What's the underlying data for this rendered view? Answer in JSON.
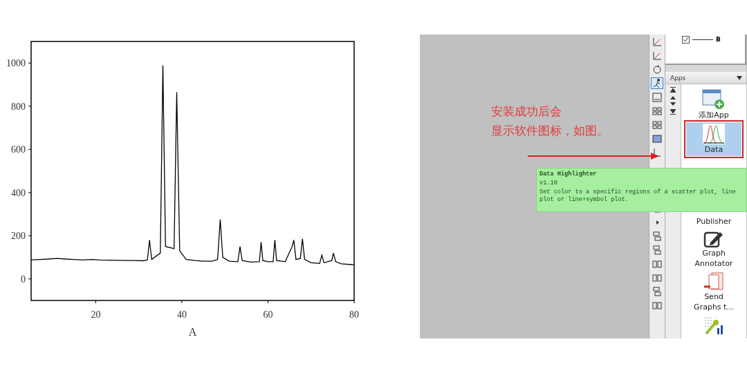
{
  "chart": {
    "chart_data": {
      "type": "line",
      "xlabel": "A",
      "xlim": [
        5,
        80
      ],
      "ylim": [
        -100,
        1100
      ],
      "xticks": [
        20,
        40,
        60,
        80
      ],
      "yticks": [
        0,
        200,
        400,
        600,
        800,
        1000
      ],
      "x": [
        5,
        7,
        9,
        11,
        13,
        15,
        17,
        19,
        21,
        23,
        25,
        27,
        29,
        31,
        32,
        32.5,
        33,
        35,
        35.6,
        36.2,
        38.2,
        38.8,
        39.5,
        41,
        43,
        45,
        47,
        48.3,
        48.9,
        49.5,
        51,
        53,
        53.5,
        54,
        56,
        58,
        58.4,
        58.8,
        60,
        61.2,
        61.6,
        62,
        64,
        65.6,
        66,
        66.5,
        67.5,
        68,
        68.5,
        70,
        72,
        72.5,
        73,
        74.8,
        75.2,
        75.7,
        77,
        80
      ],
      "series": [
        {
          "color": "#000000",
          "values": [
            88,
            90,
            92,
            95,
            92,
            90,
            88,
            90,
            88,
            87,
            86,
            85,
            85,
            84,
            88,
            180,
            90,
            120,
            990,
            150,
            140,
            865,
            130,
            90,
            85,
            82,
            82,
            90,
            275,
            100,
            82,
            80,
            150,
            85,
            78,
            80,
            170,
            85,
            80,
            80,
            180,
            85,
            80,
            150,
            180,
            90,
            95,
            185,
            90,
            75,
            72,
            110,
            75,
            85,
            120,
            80,
            70,
            65
          ]
        }
      ]
    }
  },
  "origin_window": {
    "annotation": {
      "lines": [
        "安装成功后会",
        "显示软件图标，如图。"
      ]
    },
    "toolbar": {
      "upper": [
        {
          "kind": "axes",
          "selected": false
        },
        {
          "kind": "axes",
          "selected": false
        },
        {
          "kind": "refresh",
          "selected": false
        },
        {
          "kind": "runner",
          "selected": true
        },
        {
          "kind": "frame",
          "selected": false
        },
        {
          "kind": "grid",
          "selected": false
        },
        {
          "kind": "grid",
          "selected": false
        },
        {
          "kind": "layers",
          "selected": false
        },
        {
          "kind": "corner",
          "selected": false
        }
      ],
      "lower": [
        {
          "kind": "corner",
          "selected": false
        },
        {
          "kind": "play",
          "selected": false
        },
        {
          "kind": "stack",
          "selected": false
        },
        {
          "kind": "stack",
          "selected": false
        },
        {
          "kind": "split",
          "selected": false
        },
        {
          "kind": "split",
          "selected": false
        },
        {
          "kind": "stack",
          "selected": false
        },
        {
          "kind": "split",
          "selected": false
        }
      ]
    },
    "legend": {
      "label": "B",
      "checked": true
    },
    "apps_panel": {
      "title": "Apps",
      "apps": [
        {
          "kind": "add",
          "lines": [
            "添加App"
          ],
          "highlighted": false
        },
        {
          "kind": "peaks",
          "lines": [
            "Data"
          ],
          "highlighted": true
        },
        {
          "kind": "hidden",
          "lines": [
            "Publisher"
          ]
        },
        {
          "kind": "pencil",
          "lines": [
            "Graph",
            "Annotator"
          ],
          "highlighted": false
        },
        {
          "kind": "slides",
          "lines": [
            "Send",
            "Graphs t..."
          ],
          "highlighted": false
        },
        {
          "kind": "tools",
          "highlighted": false
        }
      ]
    },
    "tooltip": {
      "title": "Data Highlighter",
      "version": "v1.10",
      "description": "Set color to a specific regions of a scatter plot, line plot or line+symbol plot."
    }
  }
}
